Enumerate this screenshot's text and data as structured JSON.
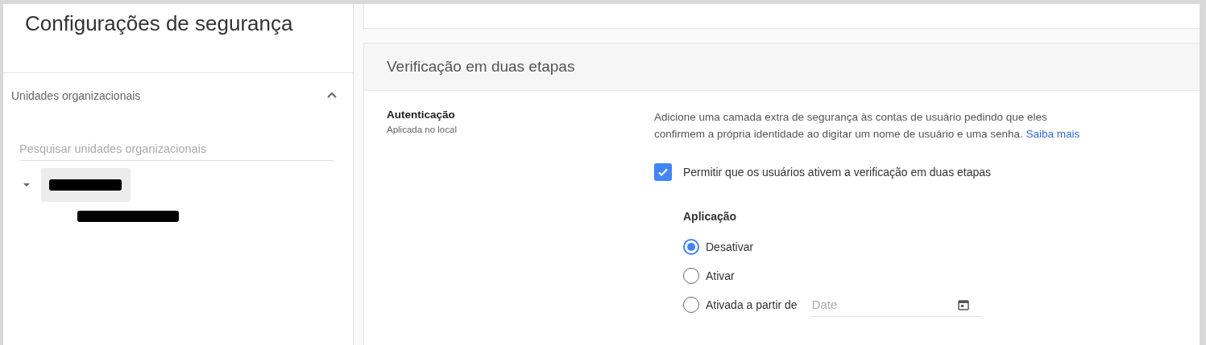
{
  "sidebar": {
    "title": "Configurações de segurança",
    "section": {
      "label": "Unidades organizacionais",
      "expanded": true
    },
    "search": {
      "placeholder": "Pesquisar unidades organizacionais"
    },
    "org_tree": [
      {
        "kind": "redacted",
        "selected": true,
        "expanded": true,
        "children": [
          {
            "kind": "redacted",
            "selected": false
          }
        ]
      }
    ]
  },
  "card": {
    "title": "Verificação em duas etapas",
    "setting": {
      "label": "Autenticação",
      "sublabel": "Aplicada no local"
    },
    "description": "Adicione uma camada extra de segurança às contas de usuário pedindo que eles confirmem a própria identidade ao digitar um nome de usuário e uma senha.",
    "link": "Saiba mais",
    "allow": {
      "label": "Permitir que os usuários ativem a verificação em duas etapas",
      "checked": true
    },
    "enforcement": {
      "label": "Aplicação",
      "options": [
        {
          "label": "Desativar",
          "selected": true
        },
        {
          "label": "Ativar",
          "selected": false
        },
        {
          "label": "Ativada a partir de",
          "selected": false,
          "kind": "date"
        }
      ],
      "date": {
        "placeholder": "Date"
      }
    }
  }
}
